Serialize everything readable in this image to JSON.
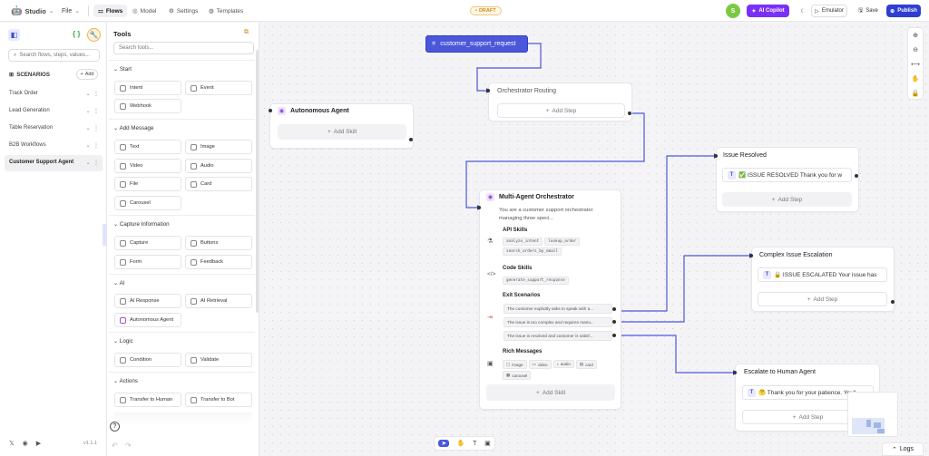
{
  "header": {
    "app_name": "Studio",
    "file_menu": "File",
    "tabs": [
      {
        "label": "Flows",
        "active": true
      },
      {
        "label": "Model",
        "active": false
      },
      {
        "label": "Settings",
        "active": false
      },
      {
        "label": "Templates",
        "active": false
      }
    ],
    "status_badge": "DRAFT",
    "avatar_initial": "S",
    "ai_copilot": "AI Copilot",
    "emulator": "Emulator",
    "save": "Save",
    "publish": "Publish"
  },
  "sidebar": {
    "search_placeholder": "Search flows, steps, values...",
    "scenarios_title": "SCENARIOS",
    "add_label": "Add",
    "scenarios": [
      "Track Order",
      "Lead Generation",
      "Table Reservation",
      "B2B Workflows",
      "Customer Support Agent"
    ],
    "version": "v1.1.1"
  },
  "tools": {
    "title": "Tools",
    "search_placeholder": "Search tools...",
    "sections": {
      "start": {
        "title": "Start",
        "items": [
          "Intent",
          "Event",
          "Webhook"
        ]
      },
      "message": {
        "title": "Add Message",
        "items": [
          "Text",
          "Image",
          "Video",
          "Audio",
          "File",
          "Card",
          "Carousel"
        ]
      },
      "capture": {
        "title": "Capture Information",
        "items": [
          "Capture",
          "Buttons",
          "Form",
          "Feedback"
        ]
      },
      "ai": {
        "title": "AI",
        "items": [
          "AI Response",
          "AI Retrieval",
          "Autonomous Agent"
        ]
      },
      "logic": {
        "title": "Logic",
        "items": [
          "Condition",
          "Validate"
        ]
      },
      "actions": {
        "title": "Actions",
        "items": [
          "Transfer to Human",
          "Transfer to Bot"
        ]
      }
    }
  },
  "canvas": {
    "trigger": "customer_support_request",
    "routing": {
      "title": "Orchestrator Routing",
      "add_step": "Add Step"
    },
    "agent": {
      "title": "Autonomous Agent",
      "add_skill": "Add Skill"
    },
    "orchestrator": {
      "title": "Multi-Agent Orchestrator",
      "description": "You are a customer support orchestrator managing three speci...",
      "api_title": "API Skills",
      "api_tags": [
        "analyze_intent",
        "lookup_order",
        "search_orders_by_email"
      ],
      "code_title": "Code Skills",
      "code_tags": [
        "generate_support_response"
      ],
      "exit_title": "Exit Scenarios",
      "exits": [
        "The customer explicitly asks to speak with a...",
        "The issue is too complex and requires manu...",
        "The issue is resolved and customer is satisf..."
      ],
      "rich_title": "Rich Messages",
      "rich_chips": [
        "image",
        "video",
        "audio",
        "card",
        "carousel"
      ],
      "add_skill": "Add Skill"
    },
    "resolved": {
      "title": "Issue Resolved",
      "message": "✅ ISSUE RESOLVED Thank you for w",
      "add_step": "Add Step"
    },
    "escalation": {
      "title": "Complex Issue Escalation",
      "message": "🔒 ISSUE ESCALATED Your issue has",
      "add_step": "Add Step"
    },
    "human": {
      "title": "Escalate to Human Agent",
      "message": "🤔 Thank you for your patience. You'l",
      "add_step": "Add Step"
    }
  },
  "logs": "Logs",
  "colors": {
    "accent": "#3b4cd1",
    "copilot": "#7b2ff7",
    "publish": "#2f3ed0"
  }
}
